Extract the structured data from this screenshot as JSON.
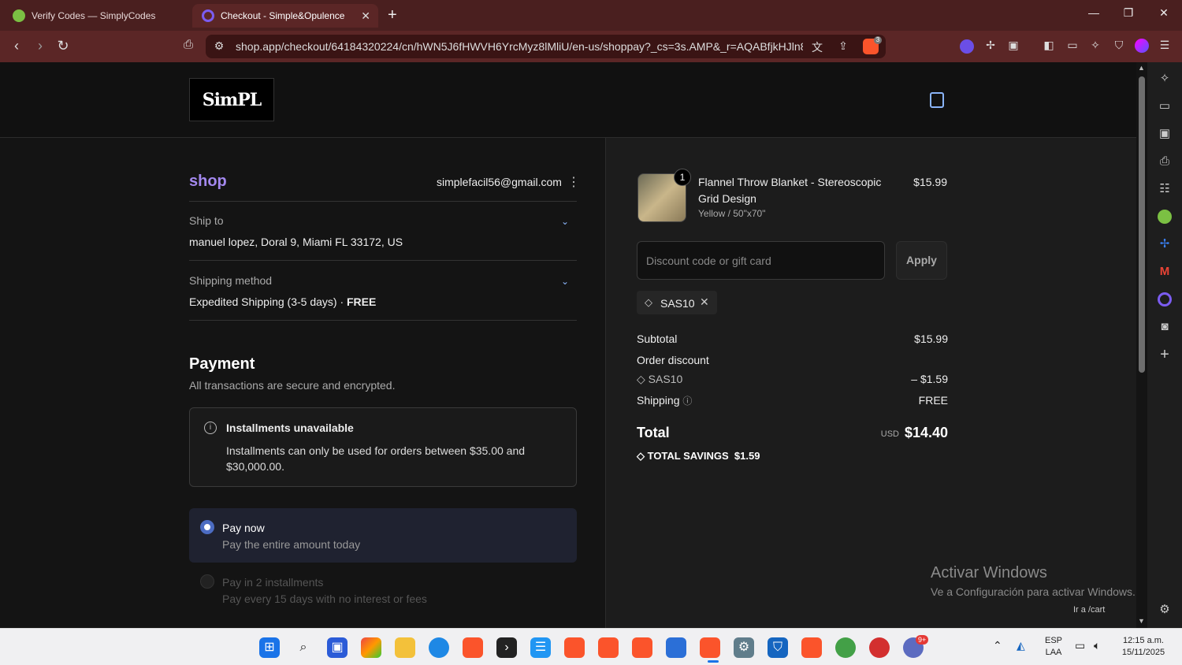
{
  "browser": {
    "tabs": [
      {
        "title": "Verify Codes — SimplyCodes",
        "active": false
      },
      {
        "title": "Checkout - Simple&Opulence",
        "active": true
      }
    ],
    "url": "shop.app/checkout/64184320224/cn/hWN5J6fHWVH6YrcMyz8lMliU/en-us/shoppay?_cs=3s.AMP&_r=AQABfjkHJln8...",
    "brave_badge": "3"
  },
  "store": {
    "logo_text": "SimPL"
  },
  "checkout": {
    "shop_label": "shop",
    "email": "simplefacil56@gmail.com",
    "ship_to_label": "Ship to",
    "ship_to_value": "manuel lopez, Doral 9, Miami FL 33172, US",
    "shipping_method_label": "Shipping method",
    "shipping_method_value": "Expedited Shipping (3-5 days) · ",
    "shipping_method_price": "FREE",
    "payment_title": "Payment",
    "payment_subtitle": "All transactions are secure and encrypted.",
    "installments_title": "Installments unavailable",
    "installments_text": "Installments can only be used for orders between $35.00 and $30,000.00.",
    "pay_now_title": "Pay now",
    "pay_now_sub": "Pay the entire amount today",
    "pay_installments_title": "Pay in 2 installments",
    "pay_installments_sub": "Pay every 15 days with no interest or fees"
  },
  "summary": {
    "product_qty": "1",
    "product_name": "Flannel Throw Blanket - Stereoscopic Grid Design",
    "product_variant": "Yellow / 50\"x70\"",
    "product_price": "$15.99",
    "discount_placeholder": "Discount code or gift card",
    "apply_label": "Apply",
    "applied_code": "SAS10",
    "subtotal_label": "Subtotal",
    "subtotal_value": "$15.99",
    "order_discount_label": "Order discount",
    "discount_code": "SAS10",
    "discount_value": "– $1.59",
    "shipping_label": "Shipping",
    "shipping_value": "FREE",
    "total_label": "Total",
    "currency": "USD",
    "total_value": "$14.40",
    "savings_label": "TOTAL SAVINGS",
    "savings_value": "$1.59"
  },
  "overlay": {
    "activate_title": "Activar Windows",
    "activate_sub": "Ve a Configuración para activar Windows.",
    "status_url": "Ir a /cart"
  },
  "taskbar": {
    "lang_top": "ESP",
    "lang_bottom": "LAA",
    "time": "12:15 a.m.",
    "date": "15/11/2025",
    "badge": "9+"
  },
  "colors": {
    "accent": "#a388ee",
    "link": "#8ab4f8",
    "titlebar": "#4a1f1f"
  }
}
